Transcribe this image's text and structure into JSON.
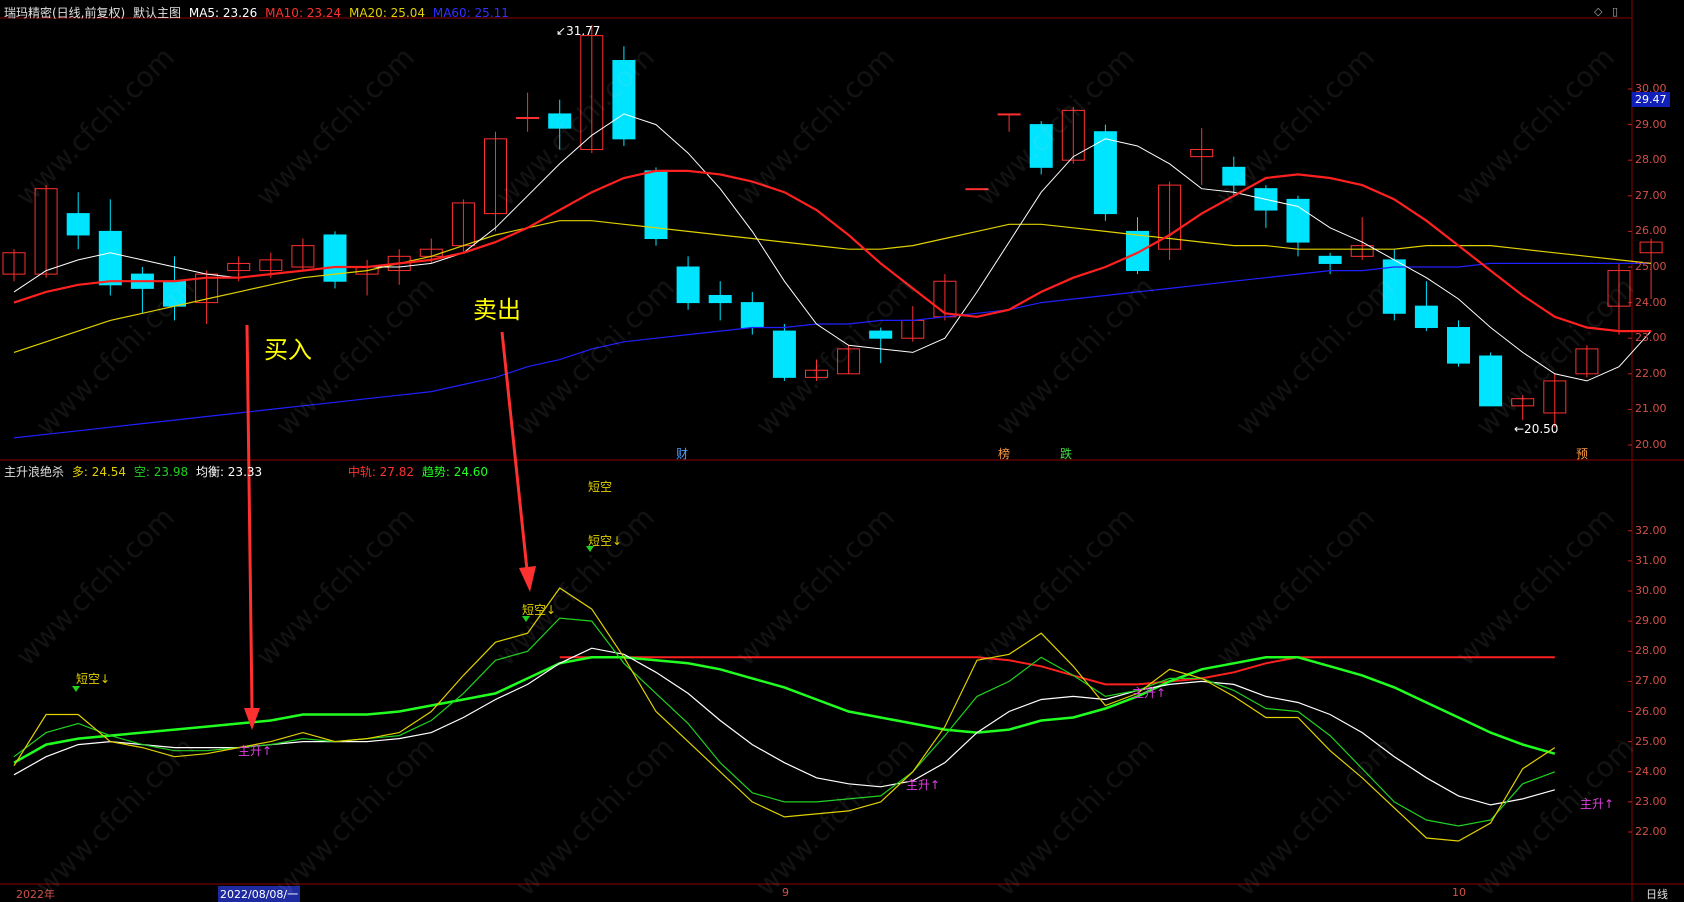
{
  "main_header": {
    "title": "瑞玛精密(日线,前复权)",
    "chart_mode": "默认主图",
    "ma5_label": "MA5: 23.26",
    "ma10_label": "MA10: 23.24",
    "ma20_label": "MA20: 25.04",
    "ma60_label": "MA60: 25.11"
  },
  "sub_header": {
    "title": "主升浪绝杀",
    "duo_label": "多: 24.54",
    "kong_label": "空: 23.98",
    "junheng_label": "均衡: 23.33",
    "zhonggui_label": "中轨: 27.82",
    "qushi_label": "趋势: 24.60"
  },
  "current_price": "29.47",
  "high_marker": "31.77",
  "low_marker": "←20.50",
  "annotations": {
    "buy": "买入",
    "sell": "卖出"
  },
  "event_markers": {
    "cai": "财",
    "bang": "榜",
    "die": "跌",
    "yu": "预"
  },
  "signals": {
    "short1": "短空↓",
    "short2": "短空↓",
    "short3": "短空↓",
    "short_partial": "短空",
    "up1": "主升↑",
    "up2": "主升↑",
    "up3": "主升↑",
    "up4": "主升↑"
  },
  "x_axis": {
    "label_start": "2022年",
    "date_cursor": "2022/08/08/一",
    "label_9": "9",
    "label_10": "10",
    "period": "日线"
  },
  "watermark": "www.cfchi.com",
  "main_price_ticks": [
    "30.00",
    "29.00",
    "28.00",
    "27.00",
    "26.00",
    "25.00",
    "24.00",
    "23.00",
    "22.00",
    "21.00",
    "20.00"
  ],
  "sub_value_ticks": [
    "32.00",
    "31.00",
    "30.00",
    "29.00",
    "28.00",
    "27.00",
    "26.00",
    "25.00",
    "24.00",
    "23.00",
    "22.00"
  ],
  "colors": {
    "up": "#ff3030",
    "down": "#00e5ff",
    "ma5": "#ffffff",
    "ma10": "#ff2020",
    "ma20": "#e0d000",
    "ma60": "#2020ff",
    "grid": "#5a0000",
    "duo": "#e0d000",
    "kong": "#20d020",
    "junheng": "#ffffff",
    "zhonggui": "#ff2020",
    "qushi": "#20ff20"
  },
  "chart_data": {
    "type": "candlestick",
    "title": "瑞玛精密(日线,前复权)",
    "ylim": [
      20.0,
      30.0
    ],
    "candles": [
      {
        "o": 24.8,
        "h": 25.5,
        "l": 24.6,
        "c": 25.4
      },
      {
        "o": 24.8,
        "h": 27.3,
        "l": 24.7,
        "c": 27.2
      },
      {
        "o": 26.5,
        "h": 27.1,
        "l": 25.5,
        "c": 25.9
      },
      {
        "o": 26.0,
        "h": 26.9,
        "l": 24.2,
        "c": 24.5
      },
      {
        "o": 24.8,
        "h": 25.0,
        "l": 23.7,
        "c": 24.4
      },
      {
        "o": 24.6,
        "h": 25.3,
        "l": 23.5,
        "c": 23.9
      },
      {
        "o": 24.0,
        "h": 24.9,
        "l": 23.4,
        "c": 24.8
      },
      {
        "o": 24.9,
        "h": 25.3,
        "l": 24.6,
        "c": 25.1
      },
      {
        "o": 24.9,
        "h": 25.4,
        "l": 24.7,
        "c": 25.2
      },
      {
        "o": 25.0,
        "h": 25.8,
        "l": 24.9,
        "c": 25.6
      },
      {
        "o": 25.9,
        "h": 26.0,
        "l": 24.4,
        "c": 24.6
      },
      {
        "o": 24.8,
        "h": 25.2,
        "l": 24.2,
        "c": 25.0
      },
      {
        "o": 24.9,
        "h": 25.5,
        "l": 24.5,
        "c": 25.3
      },
      {
        "o": 25.3,
        "h": 25.8,
        "l": 25.1,
        "c": 25.5
      },
      {
        "o": 25.6,
        "h": 26.9,
        "l": 25.4,
        "c": 26.8
      },
      {
        "o": 26.5,
        "h": 28.8,
        "l": 26.0,
        "c": 28.6
      },
      {
        "o": 29.2,
        "h": 29.9,
        "l": 28.8,
        "c": 29.2
      },
      {
        "o": 29.3,
        "h": 29.7,
        "l": 28.3,
        "c": 28.9
      },
      {
        "o": 28.3,
        "h": 31.8,
        "l": 28.2,
        "c": 31.5
      },
      {
        "o": 30.8,
        "h": 31.2,
        "l": 28.4,
        "c": 28.6
      },
      {
        "o": 27.7,
        "h": 27.8,
        "l": 25.6,
        "c": 25.8
      },
      {
        "o": 25.0,
        "h": 25.3,
        "l": 23.8,
        "c": 24.0
      },
      {
        "o": 24.2,
        "h": 24.6,
        "l": 23.5,
        "c": 24.0
      },
      {
        "o": 24.0,
        "h": 24.3,
        "l": 23.1,
        "c": 23.3
      },
      {
        "o": 23.2,
        "h": 23.4,
        "l": 21.8,
        "c": 21.9
      },
      {
        "o": 21.9,
        "h": 22.4,
        "l": 21.8,
        "c": 22.1
      },
      {
        "o": 22.0,
        "h": 22.8,
        "l": 22.0,
        "c": 22.7
      },
      {
        "o": 23.2,
        "h": 23.3,
        "l": 22.3,
        "c": 23.0
      },
      {
        "o": 23.0,
        "h": 23.9,
        "l": 22.9,
        "c": 23.5
      },
      {
        "o": 23.6,
        "h": 24.8,
        "l": 23.5,
        "c": 24.6
      },
      {
        "o": 27.2,
        "h": 27.2,
        "l": 27.2,
        "c": 27.2
      },
      {
        "o": 29.3,
        "h": 29.3,
        "l": 28.8,
        "c": 29.3
      },
      {
        "o": 29.0,
        "h": 29.1,
        "l": 27.6,
        "c": 27.8
      },
      {
        "o": 28.0,
        "h": 29.5,
        "l": 27.9,
        "c": 29.4
      },
      {
        "o": 28.8,
        "h": 29.0,
        "l": 26.3,
        "c": 26.5
      },
      {
        "o": 26.0,
        "h": 26.4,
        "l": 24.8,
        "c": 24.9
      },
      {
        "o": 25.5,
        "h": 27.4,
        "l": 25.2,
        "c": 27.3
      },
      {
        "o": 28.1,
        "h": 28.9,
        "l": 27.3,
        "c": 28.3
      },
      {
        "o": 27.8,
        "h": 28.1,
        "l": 27.0,
        "c": 27.3
      },
      {
        "o": 27.2,
        "h": 27.3,
        "l": 26.1,
        "c": 26.6
      },
      {
        "o": 26.9,
        "h": 27.0,
        "l": 25.3,
        "c": 25.7
      },
      {
        "o": 25.3,
        "h": 25.4,
        "l": 24.8,
        "c": 25.1
      },
      {
        "o": 25.3,
        "h": 26.4,
        "l": 25.2,
        "c": 25.6
      },
      {
        "o": 25.2,
        "h": 25.5,
        "l": 23.5,
        "c": 23.7
      },
      {
        "o": 23.9,
        "h": 24.6,
        "l": 23.2,
        "c": 23.3
      },
      {
        "o": 23.3,
        "h": 23.5,
        "l": 22.2,
        "c": 22.3
      },
      {
        "o": 22.5,
        "h": 22.6,
        "l": 21.1,
        "c": 21.1
      },
      {
        "o": 21.1,
        "h": 21.4,
        "l": 20.7,
        "c": 21.3
      },
      {
        "o": 20.9,
        "h": 22.0,
        "l": 20.5,
        "c": 21.8
      },
      {
        "o": 22.0,
        "h": 22.8,
        "l": 21.9,
        "c": 22.7
      },
      {
        "o": 23.9,
        "h": 25.1,
        "l": 23.1,
        "c": 24.9
      },
      {
        "o": 25.4,
        "h": 25.8,
        "l": 24.1,
        "c": 25.7
      }
    ],
    "ma5": [
      24.3,
      24.9,
      25.2,
      25.4,
      25.2,
      25.0,
      24.8,
      24.7,
      24.8,
      24.9,
      25.0,
      25.0,
      25.0,
      25.1,
      25.4,
      26.1,
      27.0,
      27.9,
      28.7,
      29.3,
      29.0,
      28.2,
      27.2,
      26.0,
      24.6,
      23.4,
      22.8,
      22.7,
      22.6,
      23.0,
      24.3,
      25.7,
      27.1,
      28.1,
      28.6,
      28.4,
      27.9,
      27.2,
      27.1,
      26.9,
      26.7,
      26.1,
      25.7,
      25.2,
      24.7,
      24.1,
      23.3,
      22.6,
      22.0,
      21.8,
      22.2,
      23.2
    ],
    "ma10": [
      24.0,
      24.3,
      24.5,
      24.6,
      24.6,
      24.6,
      24.7,
      24.7,
      24.8,
      24.9,
      25.0,
      25.0,
      25.1,
      25.2,
      25.4,
      25.7,
      26.1,
      26.6,
      27.1,
      27.5,
      27.7,
      27.7,
      27.6,
      27.4,
      27.1,
      26.6,
      25.9,
      25.1,
      24.4,
      23.7,
      23.6,
      23.8,
      24.3,
      24.7,
      25.0,
      25.4,
      25.9,
      26.5,
      27.0,
      27.5,
      27.6,
      27.5,
      27.3,
      26.9,
      26.3,
      25.6,
      24.9,
      24.2,
      23.6,
      23.3,
      23.2,
      23.2
    ],
    "ma20": [
      22.6,
      22.9,
      23.2,
      23.5,
      23.7,
      23.9,
      24.1,
      24.3,
      24.5,
      24.7,
      24.8,
      24.9,
      25.1,
      25.3,
      25.6,
      25.9,
      26.1,
      26.3,
      26.3,
      26.2,
      26.1,
      26.0,
      25.9,
      25.8,
      25.7,
      25.6,
      25.5,
      25.5,
      25.6,
      25.8,
      26.0,
      26.2,
      26.2,
      26.1,
      26.0,
      25.9,
      25.8,
      25.7,
      25.6,
      25.6,
      25.5,
      25.5,
      25.5,
      25.5,
      25.6,
      25.6,
      25.6,
      25.5,
      25.4,
      25.3,
      25.2,
      25.1
    ],
    "ma60": [
      20.2,
      20.3,
      20.4,
      20.5,
      20.6,
      20.7,
      20.8,
      20.9,
      21.0,
      21.1,
      21.2,
      21.3,
      21.4,
      21.5,
      21.7,
      21.9,
      22.2,
      22.4,
      22.7,
      22.9,
      23.0,
      23.1,
      23.2,
      23.3,
      23.3,
      23.4,
      23.4,
      23.5,
      23.5,
      23.6,
      23.7,
      23.8,
      24.0,
      24.1,
      24.2,
      24.3,
      24.4,
      24.5,
      24.6,
      24.7,
      24.8,
      24.9,
      24.9,
      25.0,
      25.0,
      25.0,
      25.1,
      25.1,
      25.1,
      25.1,
      25.1,
      25.1
    ],
    "sub_ylim": [
      21.0,
      33.5
    ],
    "duo": [
      24.2,
      25.9,
      25.9,
      25.0,
      24.8,
      24.5,
      24.6,
      24.8,
      25.0,
      25.3,
      25.0,
      25.1,
      25.3,
      26.0,
      27.2,
      28.3,
      28.6,
      30.1,
      29.4,
      27.8,
      26.0,
      25.0,
      24.0,
      23.0,
      22.5,
      22.6,
      22.7,
      23.0,
      24.0,
      25.5,
      27.7,
      27.9,
      28.6,
      27.5,
      26.2,
      26.6,
      27.4,
      27.1,
      26.5,
      25.8,
      25.8,
      24.7,
      23.8,
      22.8,
      21.8,
      21.7,
      22.3,
      24.1,
      24.8
    ],
    "kong": [
      24.5,
      25.3,
      25.6,
      25.2,
      24.9,
      24.7,
      24.7,
      24.8,
      24.9,
      25.1,
      25.0,
      25.1,
      25.2,
      25.7,
      26.6,
      27.7,
      28.0,
      29.1,
      29.0,
      27.6,
      26.6,
      25.6,
      24.3,
      23.3,
      23.0,
      23.0,
      23.1,
      23.2,
      24.0,
      25.2,
      26.5,
      27.0,
      27.8,
      27.2,
      26.5,
      26.7,
      27.1,
      27.1,
      26.7,
      26.1,
      26.0,
      25.2,
      24.1,
      23.0,
      22.4,
      22.2,
      22.4,
      23.6,
      24.0
    ],
    "junheng": [
      23.9,
      24.5,
      24.9,
      25.0,
      24.9,
      24.8,
      24.8,
      24.8,
      24.9,
      25.0,
      25.0,
      25.0,
      25.1,
      25.3,
      25.8,
      26.4,
      26.9,
      27.6,
      28.1,
      27.9,
      27.3,
      26.6,
      25.7,
      24.9,
      24.3,
      23.8,
      23.6,
      23.5,
      23.7,
      24.3,
      25.3,
      26.0,
      26.4,
      26.5,
      26.4,
      26.7,
      26.9,
      27.0,
      26.9,
      26.5,
      26.3,
      25.9,
      25.3,
      24.5,
      23.8,
      23.2,
      22.9,
      23.1,
      23.4
    ],
    "zhonggui": [
      null,
      null,
      null,
      null,
      null,
      null,
      null,
      null,
      null,
      null,
      null,
      null,
      null,
      null,
      null,
      null,
      null,
      27.8,
      27.8,
      27.8,
      27.8,
      27.8,
      27.8,
      27.8,
      27.8,
      27.8,
      27.8,
      27.8,
      27.8,
      27.8,
      27.8,
      27.7,
      27.5,
      27.2,
      26.9,
      26.9,
      27.0,
      27.1,
      27.3,
      27.6,
      27.8,
      27.8,
      27.8,
      27.8,
      27.8,
      27.8,
      27.8,
      27.8,
      27.8
    ],
    "qushi": [
      24.3,
      24.9,
      25.1,
      25.2,
      25.3,
      25.4,
      25.5,
      25.6,
      25.7,
      25.9,
      25.9,
      25.9,
      26.0,
      26.2,
      26.4,
      26.6,
      27.1,
      27.6,
      27.8,
      27.8,
      27.7,
      27.6,
      27.4,
      27.1,
      26.8,
      26.4,
      26.0,
      25.8,
      25.6,
      25.4,
      25.3,
      25.4,
      25.7,
      25.8,
      26.1,
      26.5,
      27.0,
      27.4,
      27.6,
      27.8,
      27.8,
      27.5,
      27.2,
      26.8,
      26.3,
      25.8,
      25.3,
      24.9,
      24.6
    ]
  }
}
